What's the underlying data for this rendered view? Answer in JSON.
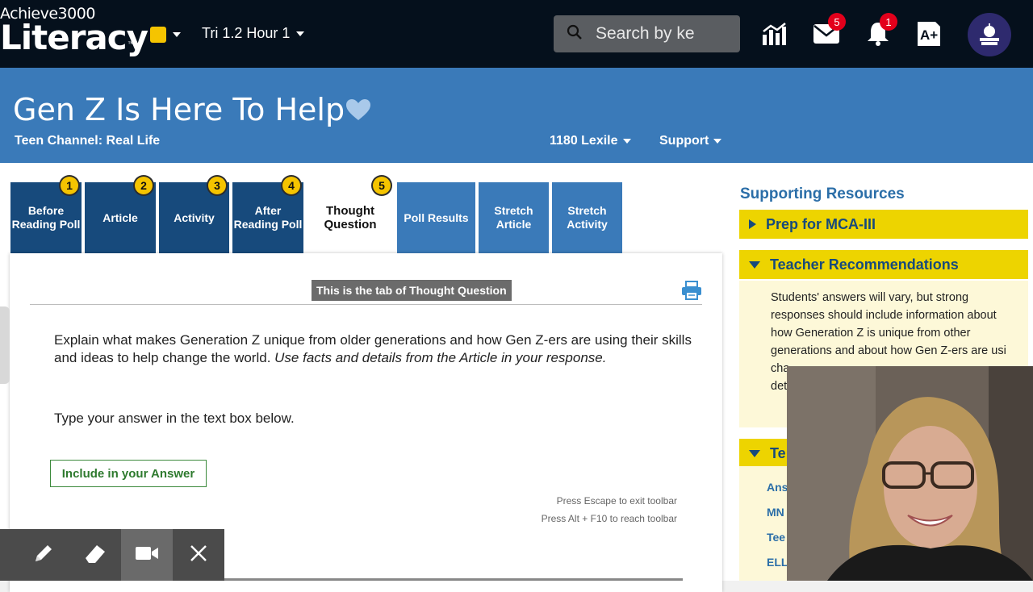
{
  "topbar": {
    "logo_small": "Achieve3000",
    "logo_big": "Literacy",
    "logo_tm": "™",
    "class_name": "Tri 1.2 Hour 1",
    "search_placeholder": "Search by ke",
    "mail_count": "5",
    "alert_count": "1",
    "gradebook_label": "A+"
  },
  "banner": {
    "title": "Gen Z Is Here To Help",
    "channel": "Teen Channel: Real Life",
    "lexile": "1180 Lexile",
    "support": "Support"
  },
  "tabs": [
    {
      "label": "Before Reading Poll",
      "num": "1"
    },
    {
      "label": "Article",
      "num": "2"
    },
    {
      "label": "Activity",
      "num": "3"
    },
    {
      "label": "After Reading Poll",
      "num": "4"
    },
    {
      "label": "Thought Question",
      "num": "5"
    },
    {
      "label": "Poll Results"
    },
    {
      "label": "Stretch Article"
    },
    {
      "label": "Stretch Activity"
    }
  ],
  "main": {
    "tooltip": "This is the tab of Thought Question",
    "question_plain": "Explain what makes Generation Z unique from older generations and how Gen Z-ers are using their skills and ideas to help change the world. ",
    "question_italic": "Use facts and details from the Article in your response.",
    "type_answer": "Type your answer in the text box below.",
    "include_button": "Include in your Answer",
    "escape_hint": "Press Escape to exit toolbar",
    "alt_hint": "Press Alt + F10 to reach toolbar"
  },
  "resources": {
    "title": "Supporting Resources",
    "prep": "Prep for MCA-III",
    "teacher_rec": "Teacher Recommendations",
    "rec_text": "Students' answers will vary, but strong responses should include information about how Generation Z is unique from other generations and about how Gen Z-ers are usi",
    "rec_fragment_1": "cha",
    "rec_fragment_2": "det",
    "third_header": "Te",
    "links": [
      "Ans",
      "MN",
      "Tee",
      "ELL"
    ]
  }
}
